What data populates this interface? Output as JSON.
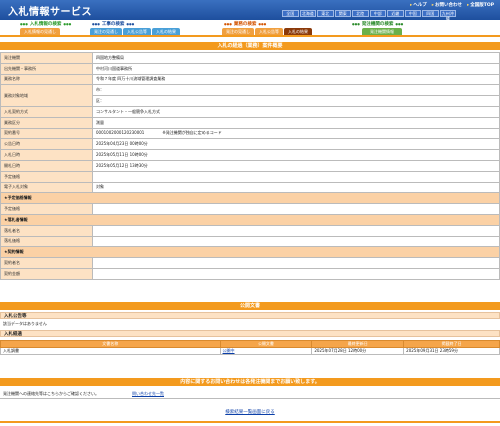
{
  "header": {
    "logo": "入札情報サービス",
    "util_links": [
      "ヘルプ",
      "お問い合わせ",
      "全国版TOP"
    ],
    "regions_row1": [
      "全国",
      "北海道",
      "東北",
      "関東",
      "北陸",
      "中部",
      "近畿",
      "中国",
      "四国",
      "九州沖縄"
    ],
    "regions_row2": [
      "",
      "",
      "",
      "",
      "",
      "",
      "",
      "",
      "",
      ""
    ]
  },
  "menus": {
    "groups": [
      {
        "title": "工事の検索",
        "color": "#1e4f9e",
        "tabs": [
          {
            "label": "発注の見通し",
            "color": "#4aa0d8"
          },
          {
            "label": "入札公告等",
            "color": "#4aa0d8"
          },
          {
            "label": "入札の結果",
            "color": "#4aa0d8"
          }
        ]
      },
      {
        "title": "業務の検索",
        "color": "#d35400",
        "tabs": [
          {
            "label": "発注の見通し",
            "color": "#f0a040"
          },
          {
            "label": "入札公告等",
            "color": "#f0a040"
          },
          {
            "label": "入札の結果",
            "color": "#8b3a0a"
          }
        ]
      },
      {
        "title": "発注機関の検索",
        "color": "#2a8a2a",
        "tabs": [
          {
            "label": "発注機関情報",
            "color": "#6ab04a"
          }
        ]
      }
    ],
    "left_title": "入札情報の検索",
    "left_tab": "入札情報の見通し"
  },
  "main": {
    "title": "入札の経過（業務）案件概要",
    "rows": [
      {
        "label": "発注機関",
        "value": "四国地方整備局"
      },
      {
        "label": "出先機関・事務所",
        "value": "中村河川国道事務所"
      },
      {
        "label": "業務名称",
        "value": "令和７年度 四万十川流域管理調査業務"
      },
      {
        "label": "業務対象地域",
        "value": "市：",
        "value2": "区："
      },
      {
        "label": "入札契約方式",
        "value": "コンサルタント・一般競争入札方式"
      },
      {
        "label": "業務区分",
        "value": "測量"
      },
      {
        "label": "契約番号",
        "value": "0001002000120230001",
        "note": "※発注機関が独自に定めるコード"
      },
      {
        "label": "公告日時",
        "value": "2025年04月23日 00時00分"
      },
      {
        "label": "入札日時",
        "value": "2025年05月11日 10時00分"
      },
      {
        "label": "開札日時",
        "value": "2025年05月12日 13時30分"
      },
      {
        "label": "予定価格",
        "value": ""
      },
      {
        "label": "電子入札対象",
        "value": "対象"
      },
      {
        "section": "★予定価格情報"
      },
      {
        "label": "予定価格",
        "value": ""
      },
      {
        "section": "★落札者情報"
      },
      {
        "label": "落札者名",
        "value": ""
      },
      {
        "label": "落札価格",
        "value": ""
      },
      {
        "section": "★契約情報"
      },
      {
        "label": "契約者名",
        "value": ""
      },
      {
        "label": "契約金額",
        "value": ""
      }
    ]
  },
  "public_docs": {
    "title": "公開文書",
    "notice_heading": "入札公告等",
    "notice_text": "該当データはありません",
    "result_heading": "入札経過",
    "columns": [
      "文書名称",
      "公開文書",
      "最終更新日",
      "掲載終了日"
    ],
    "rows": [
      {
        "name": "入札調書",
        "doc": "公開中",
        "updated": "2025年07月28日 12時00分",
        "end": "2025年09月31日 23時59分"
      }
    ]
  },
  "contact": {
    "title": "内容に関するお問い合わせは各発注機関までお願い致します。",
    "text": "発注機関への連絡先等はこちらからご確認ください。",
    "link": "問い合わせ先一覧"
  },
  "back_link": "検索結果一覧画面に戻る"
}
